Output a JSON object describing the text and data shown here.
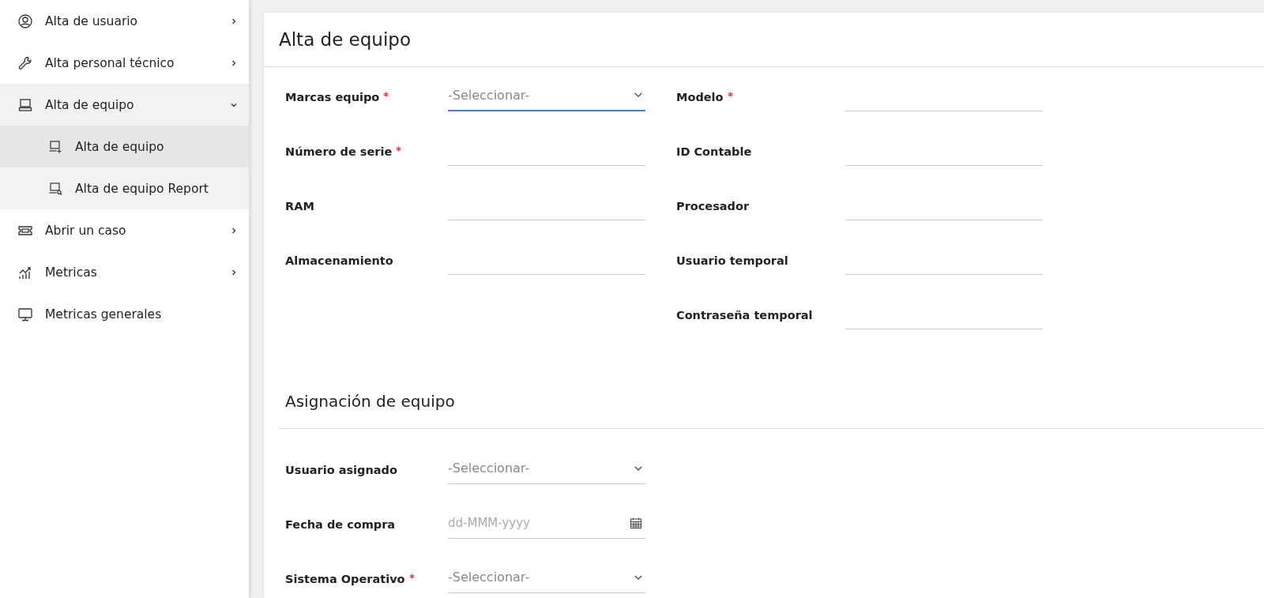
{
  "sidebar": {
    "items": [
      {
        "label": "Alta de usuario",
        "expanded": false
      },
      {
        "label": "Alta personal técnico",
        "expanded": false
      },
      {
        "label": "Alta de equipo",
        "expanded": true,
        "children": [
          {
            "label": "Alta de equipo",
            "selected": true
          },
          {
            "label": "Alta de equipo Report",
            "selected": false
          }
        ]
      },
      {
        "label": "Abrir un caso",
        "expanded": false
      },
      {
        "label": "Metricas",
        "expanded": false
      },
      {
        "label": "Metricas generales"
      }
    ]
  },
  "form": {
    "title": "Alta de equipo",
    "columns": [
      [
        {
          "label": "Marcas equipo",
          "required": true,
          "kind": "select",
          "placeholder": "-Seleccionar-",
          "focused": true
        },
        {
          "label": "Número de serie",
          "required": true,
          "kind": "text",
          "focused": false
        },
        {
          "label": "RAM",
          "required": false,
          "kind": "text",
          "focused": false
        },
        {
          "label": "Almacenamiento",
          "required": false,
          "kind": "text",
          "focused": false
        }
      ],
      [
        {
          "label": "Modelo",
          "required": true,
          "kind": "text",
          "focused": false
        },
        {
          "label": "ID Contable",
          "required": false,
          "kind": "text",
          "focused": false
        },
        {
          "label": "Procesador",
          "required": false,
          "kind": "text",
          "focused": false
        },
        {
          "label": "Usuario temporal",
          "required": false,
          "kind": "text",
          "focused": false
        },
        {
          "label": "Contraseña temporal",
          "required": false,
          "kind": "text",
          "focused": false
        }
      ]
    ],
    "section": {
      "title": "Asignación de equipo",
      "fields": [
        {
          "label": "Usuario asignado",
          "required": false,
          "kind": "select",
          "placeholder": "-Seleccionar-",
          "focused": false
        },
        {
          "label": "Fecha de compra",
          "required": false,
          "kind": "date",
          "placeholder": "dd-MMM-yyyy",
          "focused": false
        },
        {
          "label": "Sistema Operativo",
          "required": true,
          "kind": "select",
          "placeholder": "-Seleccionar-",
          "focused": false
        }
      ]
    }
  }
}
